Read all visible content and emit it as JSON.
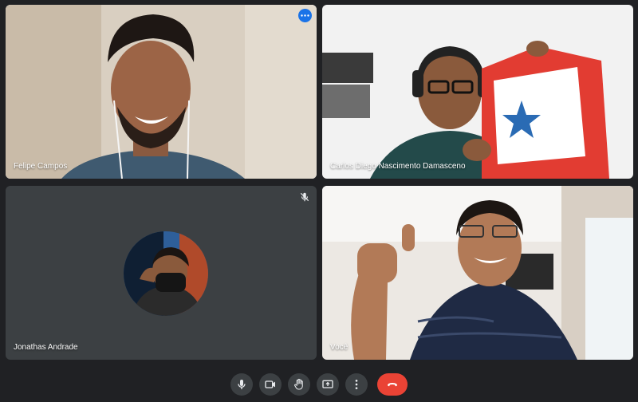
{
  "participants": [
    {
      "name": "Felipe Campos",
      "active_speaker": true,
      "camera": "on"
    },
    {
      "name": "Carlos Diego Nascimento Damasceno",
      "camera": "on"
    },
    {
      "name": "Jonathas Andrade",
      "camera": "off",
      "muted": true
    },
    {
      "name": "Você",
      "camera": "on"
    }
  ],
  "icons": {
    "more_options": "more-options-icon",
    "muted": "mic-off-icon"
  },
  "controls": [
    {
      "id": "microphone",
      "icon": "mic-icon"
    },
    {
      "id": "camera",
      "icon": "camera-icon"
    },
    {
      "id": "raise_hand",
      "icon": "hand-icon"
    },
    {
      "id": "present",
      "icon": "present-screen-icon"
    },
    {
      "id": "more",
      "icon": "more-vertical-icon"
    },
    {
      "id": "leave_call",
      "icon": "hang-up-icon"
    }
  ],
  "colors": {
    "background": "#202124",
    "tile": "#3c4043",
    "active_border": "#8ab4f8",
    "accent": "#1a73e8",
    "hangup": "#ea4335"
  }
}
